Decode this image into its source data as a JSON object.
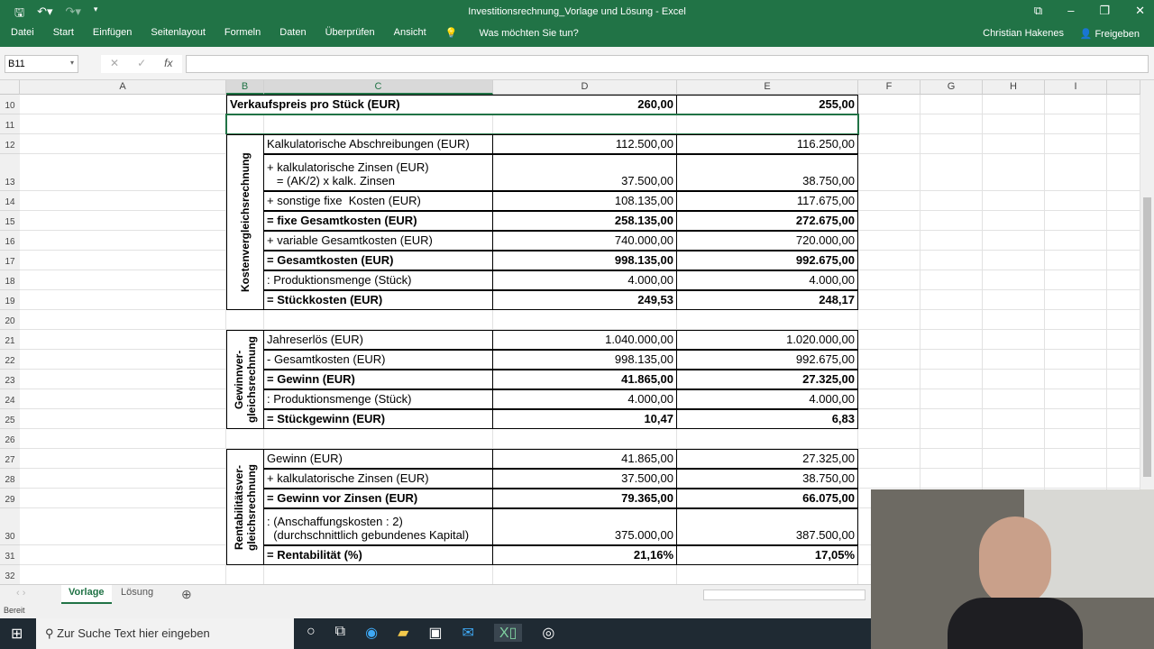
{
  "window": {
    "title": "Investitionsrechnung_Vorlage und Lösung - Excel",
    "user": "Christian Hakenes",
    "share": "Freigeben"
  },
  "menu": [
    "Datei",
    "Start",
    "Einfügen",
    "Seitenlayout",
    "Formeln",
    "Daten",
    "Überprüfen",
    "Ansicht"
  ],
  "tell_me": "Was möchten Sie tun?",
  "namebox": "B11",
  "fx_label": "fx",
  "columns": [
    "A",
    "B",
    "C",
    "D",
    "E",
    "F",
    "G",
    "H",
    "I"
  ],
  "rows": [
    {
      "n": "10",
      "label": "Verkaufspreis pro Stück (EUR)",
      "d": "260,00",
      "e": "255,00",
      "bold": true,
      "merged": true
    },
    {
      "n": "11",
      "label": "",
      "d": "",
      "e": ""
    },
    {
      "n": "12",
      "label": "Kalkulatorische Abschreibungen (EUR)",
      "d": "112.500,00",
      "e": "116.250,00"
    },
    {
      "n": "13",
      "label": "+ kalkulatorische Zinsen (EUR)\n   = (AK/2) x kalk. Zinsen",
      "d": "37.500,00",
      "e": "38.750,00"
    },
    {
      "n": "14",
      "label": "+ sonstige fixe  Kosten (EUR)",
      "d": "108.135,00",
      "e": "117.675,00"
    },
    {
      "n": "15",
      "label": "= fixe Gesamtkosten (EUR)",
      "d": "258.135,00",
      "e": "272.675,00",
      "bold": true
    },
    {
      "n": "16",
      "label": "+ variable Gesamtkosten (EUR)",
      "d": "740.000,00",
      "e": "720.000,00"
    },
    {
      "n": "17",
      "label": "= Gesamtkosten (EUR)",
      "d": "998.135,00",
      "e": "992.675,00",
      "bold": true
    },
    {
      "n": "18",
      "label": ": Produktionsmenge (Stück)",
      "d": "4.000,00",
      "e": "4.000,00"
    },
    {
      "n": "19",
      "label": "= Stückkosten (EUR)",
      "d": "249,53",
      "e": "248,17",
      "bold": true
    },
    {
      "n": "20",
      "label": "",
      "d": "",
      "e": ""
    },
    {
      "n": "21",
      "label": "Jahreserlös (EUR)",
      "d": "1.040.000,00",
      "e": "1.020.000,00"
    },
    {
      "n": "22",
      "label": "- Gesamtkosten (EUR)",
      "d": "998.135,00",
      "e": "992.675,00"
    },
    {
      "n": "23",
      "label": "= Gewinn (EUR)",
      "d": "41.865,00",
      "e": "27.325,00",
      "bold": true
    },
    {
      "n": "24",
      "label": ": Produktionsmenge (Stück)",
      "d": "4.000,00",
      "e": "4.000,00"
    },
    {
      "n": "25",
      "label": "= Stückgewinn (EUR)",
      "d": "10,47",
      "e": "6,83",
      "bold": true
    },
    {
      "n": "26",
      "label": "",
      "d": "",
      "e": ""
    },
    {
      "n": "27",
      "label": "Gewinn (EUR)",
      "d": "41.865,00",
      "e": "27.325,00"
    },
    {
      "n": "28",
      "label": "+ kalkulatorische Zinsen (EUR)",
      "d": "37.500,00",
      "e": "38.750,00"
    },
    {
      "n": "29",
      "label": "= Gewinn vor Zinsen (EUR)",
      "d": "79.365,00",
      "e": "66.075,00",
      "bold": true
    },
    {
      "n": "30",
      "label": ": (Anschaffungskosten : 2)\n  (durchschnittlich gebundenes Kapital)",
      "d": "375.000,00",
      "e": "387.500,00"
    },
    {
      "n": "31",
      "label": "= Rentabilität (%)",
      "d": "21,16%",
      "e": "17,05%",
      "bold": true
    },
    {
      "n": "32",
      "label": "",
      "d": "",
      "e": ""
    }
  ],
  "sections": [
    {
      "label": "Kostenvergleichsrechnung",
      "from": "12",
      "to": "19"
    },
    {
      "label": "Gewinnver-\ngleichsrechnung",
      "from": "21",
      "to": "25"
    },
    {
      "label": "Rentabilitätsver-\ngleichsrechnung",
      "from": "27",
      "to": "31"
    }
  ],
  "sheets": {
    "active": "Vorlage",
    "other": "Lösung"
  },
  "status": "Bereit",
  "taskbar": {
    "search_placeholder": "Zur Suche Text hier eingeben"
  }
}
